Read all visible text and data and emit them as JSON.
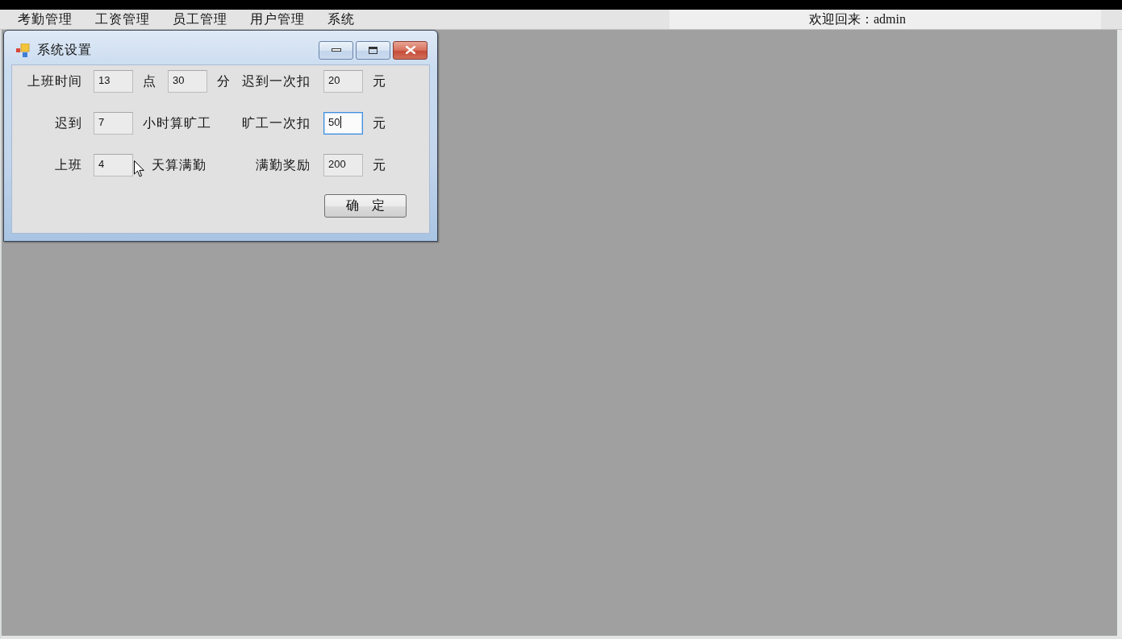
{
  "menu_bar": {
    "items": [
      {
        "label": "考勤管理"
      },
      {
        "label": "工资管理"
      },
      {
        "label": "员工管理"
      },
      {
        "label": "用户管理"
      },
      {
        "label": "系统"
      }
    ],
    "welcome": "欢迎回来：admin"
  },
  "dialog": {
    "title": "系统设置",
    "rows": [
      [
        {
          "label": "上班时间",
          "inputs": [
            {
              "value": "13",
              "focused": false,
              "suffix": "点"
            },
            {
              "value": "30",
              "focused": false,
              "suffix": "分"
            }
          ]
        },
        {
          "label": "迟到一次扣",
          "inputs": [
            {
              "value": "20",
              "focused": false,
              "suffix": "元"
            }
          ]
        }
      ],
      [
        {
          "label": "迟到",
          "inputs": [
            {
              "value": "7",
              "focused": false,
              "suffix": "小时算旷工"
            }
          ]
        },
        {
          "label": "旷工一次扣",
          "inputs": [
            {
              "value": "50",
              "focused": true,
              "suffix": "元"
            }
          ]
        }
      ],
      [
        {
          "label": "上班",
          "inputs": [
            {
              "value": "4",
              "focused": false,
              "suffix": "天算满勤"
            }
          ]
        },
        {
          "label": "满勤奖励",
          "inputs": [
            {
              "value": "200",
              "focused": false,
              "suffix": "元"
            }
          ]
        }
      ]
    ],
    "confirm_button": "确　定"
  }
}
